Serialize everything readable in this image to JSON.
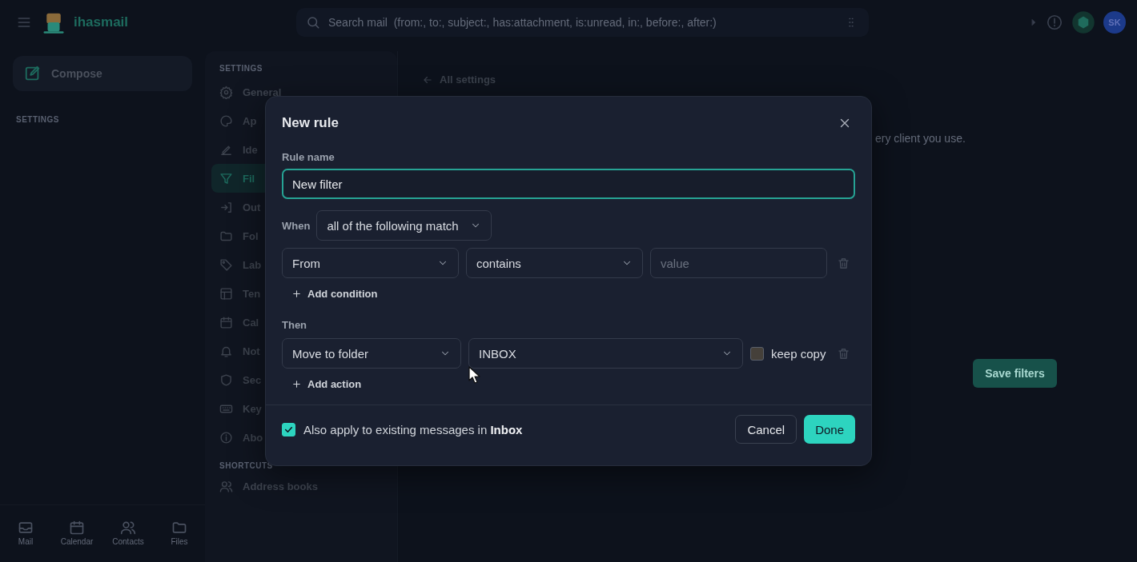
{
  "topbar": {
    "app_name": "ihasmail",
    "search": {
      "placeholder": "Search mail  (from:, to:, subject:, has:attachment, is:unread, in:, before:, after:)"
    },
    "avatar": "SK"
  },
  "sidebar": {
    "compose": "Compose",
    "section": "SETTINGS",
    "bottom_nav": [
      {
        "label": "Mail"
      },
      {
        "label": "Calendar"
      },
      {
        "label": "Contacts"
      },
      {
        "label": "Files"
      }
    ]
  },
  "settings_nav": {
    "heading": "SETTINGS",
    "items": [
      {
        "label": "General",
        "selected": false
      },
      {
        "label": "Ap",
        "selected": false
      },
      {
        "label": "Ide",
        "selected": false
      },
      {
        "label": "Fil",
        "selected": true
      },
      {
        "label": "Out",
        "selected": false
      },
      {
        "label": "Fol",
        "selected": false
      },
      {
        "label": "Lab",
        "selected": false
      },
      {
        "label": "Ten",
        "selected": false
      },
      {
        "label": "Cal",
        "selected": false
      },
      {
        "label": "Not",
        "selected": false
      },
      {
        "label": "Sec",
        "selected": false
      },
      {
        "label": "Key",
        "selected": false
      },
      {
        "label": "Abo",
        "selected": false
      }
    ],
    "shortcuts_heading": "SHORTCUTS",
    "shortcuts": [
      {
        "label": "Address books",
        "selected": false
      }
    ]
  },
  "main": {
    "back_link": "All settings",
    "description": "ery client you use.",
    "save_button": "Save filters"
  },
  "dialog": {
    "title": "New rule",
    "rule_name": {
      "label": "Rule name",
      "value": "New filter"
    },
    "when": {
      "label": "When",
      "match": "all of the following match"
    },
    "conditions": [
      {
        "field": "From",
        "operator": "contains",
        "placeholder": "value"
      }
    ],
    "add_condition": "Add condition",
    "then_label": "Then",
    "actions": [
      {
        "action": "Move to folder",
        "folder": "INBOX",
        "keep_copy": {
          "label": "keep copy",
          "checked": false
        }
      }
    ],
    "add_action": "Add action",
    "apply_existing": {
      "text": "Also apply to existing messages in **Inbox**",
      "checked": true
    },
    "buttons": [
      {
        "label": "Cancel",
        "kind": "secondary"
      },
      {
        "label": "Done",
        "kind": "primary"
      }
    ]
  }
}
